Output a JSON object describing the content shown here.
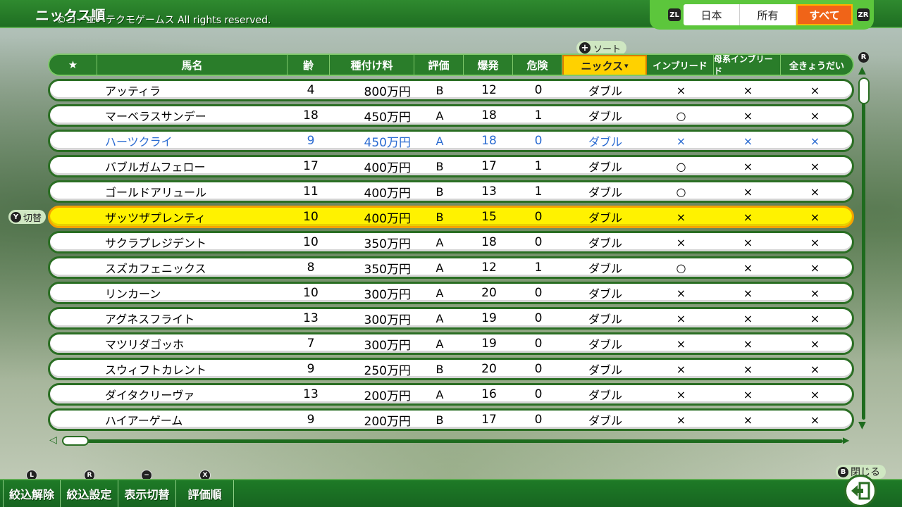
{
  "header": {
    "title": "ニックス順",
    "copyright": "©コーエーテクモゲームス All rights reserved.",
    "left_trigger": "ZL",
    "right_trigger": "ZR",
    "filters": [
      "日本",
      "所有",
      "すべて"
    ],
    "active_filter": "すべて"
  },
  "sort_hint": {
    "icon": "+",
    "label": "ソート"
  },
  "columns": {
    "star": "★",
    "name": "馬名",
    "age": "齢",
    "fee": "種付け料",
    "eval": "評価",
    "burst": "爆発",
    "risk": "危険",
    "nicks": "ニックス",
    "sort_indicator": "▾",
    "inbreed": "インブリード",
    "dam_inbreed": "母系インブリード",
    "full_siblings": "全きょうだい"
  },
  "toggle": {
    "icon": "Y",
    "label": "切替"
  },
  "rows": [
    {
      "name": "アッティラ",
      "age": "4",
      "fee": "800万円",
      "eval": "B",
      "burst": "12",
      "risk": "0",
      "nicks": "ダブル",
      "inb": "×",
      "dam": "×",
      "sib": "×"
    },
    {
      "name": "マーベラスサンデー",
      "age": "18",
      "fee": "450万円",
      "eval": "A",
      "burst": "18",
      "risk": "1",
      "nicks": "ダブル",
      "inb": "○",
      "dam": "×",
      "sib": "×"
    },
    {
      "name": "ハーツクライ",
      "age": "9",
      "fee": "450万円",
      "eval": "A",
      "burst": "18",
      "risk": "0",
      "nicks": "ダブル",
      "inb": "×",
      "dam": "×",
      "sib": "×"
    },
    {
      "name": "バブルガムフェロー",
      "age": "17",
      "fee": "400万円",
      "eval": "B",
      "burst": "17",
      "risk": "1",
      "nicks": "ダブル",
      "inb": "○",
      "dam": "×",
      "sib": "×"
    },
    {
      "name": "ゴールドアリュール",
      "age": "11",
      "fee": "400万円",
      "eval": "B",
      "burst": "13",
      "risk": "1",
      "nicks": "ダブル",
      "inb": "○",
      "dam": "×",
      "sib": "×"
    },
    {
      "name": "ザッツザプレンティ",
      "age": "10",
      "fee": "400万円",
      "eval": "B",
      "burst": "15",
      "risk": "0",
      "nicks": "ダブル",
      "inb": "×",
      "dam": "×",
      "sib": "×"
    },
    {
      "name": "サクラプレジデント",
      "age": "10",
      "fee": "350万円",
      "eval": "A",
      "burst": "18",
      "risk": "0",
      "nicks": "ダブル",
      "inb": "×",
      "dam": "×",
      "sib": "×"
    },
    {
      "name": "スズカフェニックス",
      "age": "8",
      "fee": "350万円",
      "eval": "A",
      "burst": "12",
      "risk": "1",
      "nicks": "ダブル",
      "inb": "○",
      "dam": "×",
      "sib": "×"
    },
    {
      "name": "リンカーン",
      "age": "10",
      "fee": "300万円",
      "eval": "A",
      "burst": "20",
      "risk": "0",
      "nicks": "ダブル",
      "inb": "×",
      "dam": "×",
      "sib": "×"
    },
    {
      "name": "アグネスフライト",
      "age": "13",
      "fee": "300万円",
      "eval": "A",
      "burst": "19",
      "risk": "0",
      "nicks": "ダブル",
      "inb": "×",
      "dam": "×",
      "sib": "×"
    },
    {
      "name": "マツリダゴッホ",
      "age": "7",
      "fee": "300万円",
      "eval": "A",
      "burst": "19",
      "risk": "0",
      "nicks": "ダブル",
      "inb": "×",
      "dam": "×",
      "sib": "×"
    },
    {
      "name": "スウィフトカレント",
      "age": "9",
      "fee": "250万円",
      "eval": "B",
      "burst": "20",
      "risk": "0",
      "nicks": "ダブル",
      "inb": "×",
      "dam": "×",
      "sib": "×"
    },
    {
      "name": "ダイタクリーヴァ",
      "age": "13",
      "fee": "200万円",
      "eval": "A",
      "burst": "16",
      "risk": "0",
      "nicks": "ダブル",
      "inb": "×",
      "dam": "×",
      "sib": "×"
    },
    {
      "name": "ハイアーゲーム",
      "age": "9",
      "fee": "200万円",
      "eval": "B",
      "burst": "17",
      "risk": "0",
      "nicks": "ダブル",
      "inb": "×",
      "dam": "×",
      "sib": "×"
    }
  ],
  "blue_row_index": 2,
  "highlight_row_index": 5,
  "scroll": {
    "up_arrow": "▲",
    "down_arrow": "▼",
    "left_arrow": "◁",
    "right_arrow": "▶",
    "r_icon": "R"
  },
  "footer": {
    "buttons": [
      {
        "icon": "L",
        "label": "絞込解除"
      },
      {
        "icon": "R",
        "label": "絞込設定"
      },
      {
        "icon": "−",
        "label": "表示切替"
      },
      {
        "icon": "X",
        "label": "評価順"
      }
    ],
    "close": {
      "icon": "B",
      "label": "閉じる"
    },
    "exit_icon": "exit-icon"
  },
  "colors": {
    "accent_green": "#2a7d2a",
    "highlight_yellow": "#fff200",
    "active_filter": "#f06418",
    "link_blue": "#2a6bd1"
  }
}
